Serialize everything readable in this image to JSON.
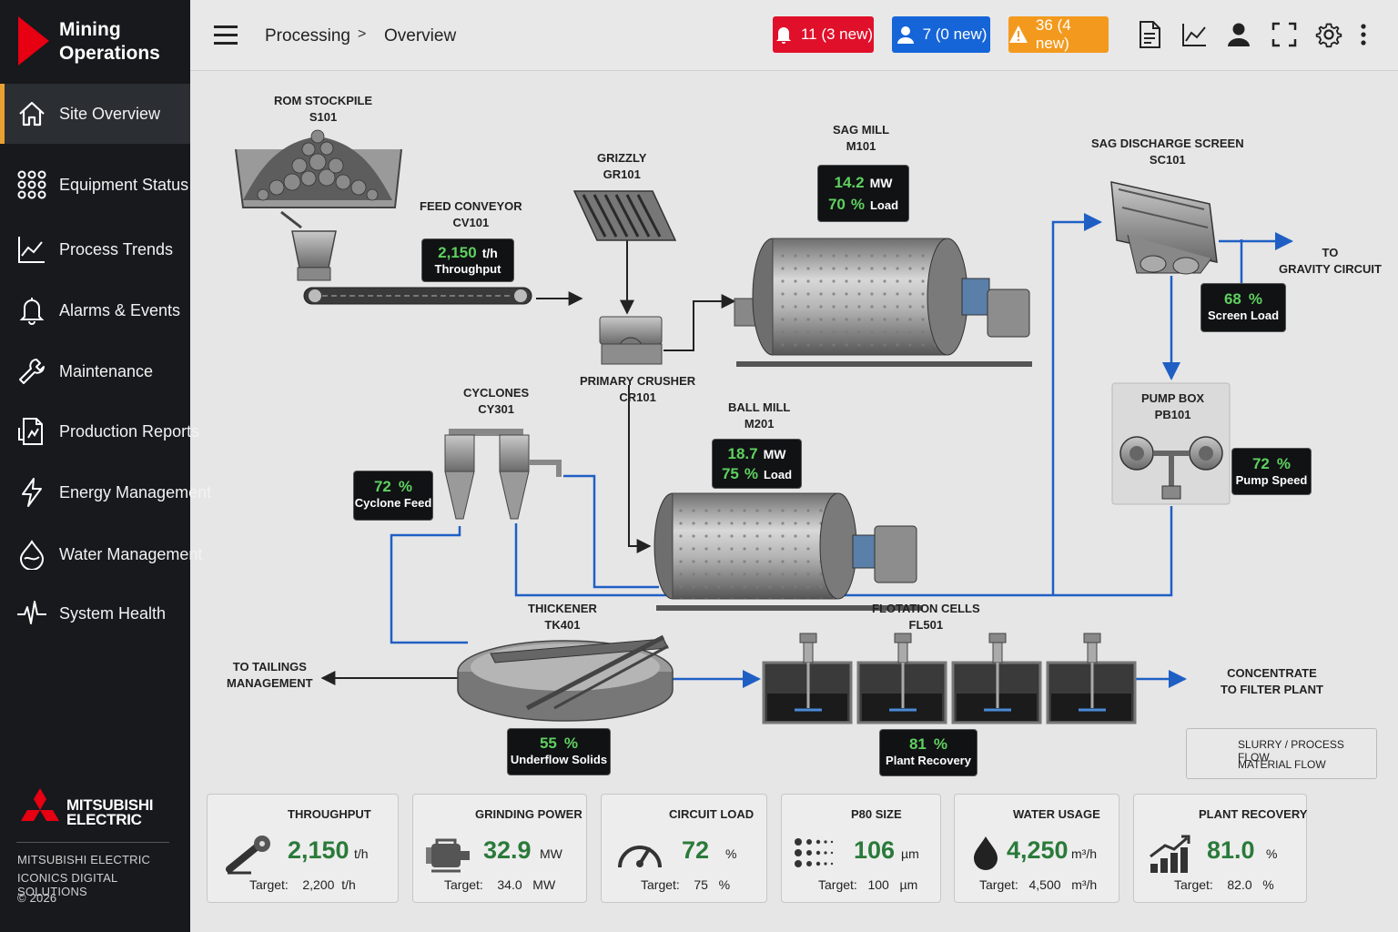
{
  "brand": {
    "line1": "Mining",
    "line2": "Operations"
  },
  "nav": [
    {
      "label": "Site Overview"
    },
    {
      "label": "Equipment Status"
    },
    {
      "label": "Process Trends"
    },
    {
      "label": "Alarms & Events"
    },
    {
      "label": "Maintenance"
    },
    {
      "label": "Production Reports"
    },
    {
      "label": "Energy Management"
    },
    {
      "label": "Water Management"
    },
    {
      "label": "System Health"
    }
  ],
  "footer": {
    "logo_line1": "MITSUBISHI",
    "logo_line2": "ELECTRIC",
    "company": "MITSUBISHI ELECTRIC",
    "division": "ICONICS DIGITAL SOLUTIONS",
    "copyright": "© 2026"
  },
  "breadcrumb": {
    "parent": "Processing",
    "separator": ">",
    "current": "Overview"
  },
  "badges": {
    "alarms": {
      "label": "11 (3 new)",
      "color": "#e0102a"
    },
    "users": {
      "label": "7 (0 new)",
      "color": "#1565d8"
    },
    "warnings": {
      "label": "36 (4 new)",
      "color": "#f39a1e"
    }
  },
  "process": {
    "rom": {
      "name": "ROM STOCKPILE",
      "tag": "S101"
    },
    "feed_conveyor": {
      "name": "FEED CONVEYOR",
      "tag": "CV101",
      "value": "2,150",
      "unit": "t/h",
      "sub": "Throughput"
    },
    "grizzly": {
      "name": "GRIZZLY",
      "tag": "GR101"
    },
    "primary_crusher": {
      "name": "PRIMARY CRUSHER",
      "tag": "CR101"
    },
    "sag_mill": {
      "name": "SAG MILL",
      "tag": "M101",
      "power": "14.2",
      "power_unit": "MW",
      "load": "70",
      "load_unit": "%",
      "load_label": "Load"
    },
    "sag_screen": {
      "name": "SAG DISCHARGE SCREEN",
      "tag": "SC101",
      "value": "68",
      "unit": "%",
      "sub": "Screen Load"
    },
    "gravity": {
      "line1": "TO",
      "line2": "GRAVITY CIRCUIT"
    },
    "pump_box": {
      "name": "PUMP BOX",
      "tag": "PB101",
      "value": "72",
      "unit": "%",
      "sub": "Pump Speed"
    },
    "ball_mill": {
      "name": "BALL MILL",
      "tag": "M201",
      "power": "18.7",
      "power_unit": "MW",
      "load": "75",
      "load_unit": "%",
      "load_label": "Load"
    },
    "cyclones": {
      "name": "CYCLONES",
      "tag": "CY301",
      "value": "72",
      "unit": "%",
      "sub": "Cyclone Feed"
    },
    "thickener": {
      "name": "THICKENER",
      "tag": "TK401",
      "value": "55",
      "unit": "%",
      "sub": "Underflow Solids"
    },
    "tailings": {
      "line1": "TO TAILINGS",
      "line2": "MANAGEMENT"
    },
    "flotation": {
      "name": "FLOTATION CELLS",
      "tag": "FL501",
      "value": "81",
      "unit": "%",
      "sub": "Plant Recovery"
    },
    "concentrate": {
      "line1": "CONCENTRATE",
      "line2": "TO FILTER PLANT"
    }
  },
  "legend": {
    "slurry": "SLURRY / PROCESS FLOW",
    "material": "MATERIAL FLOW",
    "slurry_color": "#1f5fc4",
    "material_color": "#222222"
  },
  "kpis": [
    {
      "title": "THROUGHPUT",
      "value": "2,150",
      "unit": "t/h",
      "target_label": "Target:",
      "target": "2,200",
      "target_unit": "t/h"
    },
    {
      "title": "GRINDING POWER",
      "value": "32.9",
      "unit": "MW",
      "target_label": "Target:",
      "target": "34.0",
      "target_unit": "MW"
    },
    {
      "title": "CIRCUIT LOAD",
      "value": "72",
      "unit": "%",
      "target_label": "Target:",
      "target": "75",
      "target_unit": "%"
    },
    {
      "title": "P80 SIZE",
      "value": "106",
      "unit": "µm",
      "target_label": "Target:",
      "target": "100",
      "target_unit": "µm"
    },
    {
      "title": "WATER USAGE",
      "value": "4,250",
      "unit": "m³/h",
      "target_label": "Target:",
      "target": "4,500",
      "target_unit": "m³/h"
    },
    {
      "title": "PLANT RECOVERY",
      "value": "81.0",
      "unit": "%",
      "target_label": "Target:",
      "target": "82.0",
      "target_unit": "%"
    }
  ]
}
